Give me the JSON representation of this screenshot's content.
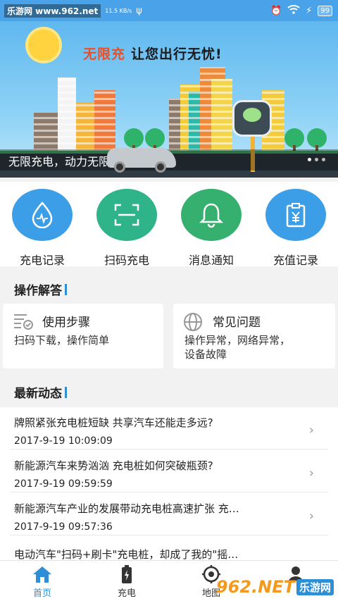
{
  "status_bar": {
    "watermark": "乐游网 www.962.net",
    "speed": "11.5 KB/s",
    "battery": "99"
  },
  "banner": {
    "slogan_highlight": "无限充",
    "slogan_rest": "让您出行无忧!",
    "caption": "无限充电，动力无限"
  },
  "quick_actions": [
    {
      "label": "充电记录",
      "icon": "droplet-pulse-icon",
      "color": "#3d9ee8"
    },
    {
      "label": "扫码充电",
      "icon": "scan-icon",
      "color": "#2fb48a"
    },
    {
      "label": "消息通知",
      "icon": "bell-icon",
      "color": "#36b06e"
    },
    {
      "label": "充值记录",
      "icon": "yen-clipboard-icon",
      "color": "#3d9ee8"
    }
  ],
  "faq": {
    "title": "操作解答",
    "cards": [
      {
        "title": "使用步骤",
        "desc": "扫码下载，操作简单"
      },
      {
        "title": "常见问题",
        "desc_line1": "操作异常，网络异常，",
        "desc_line2": "设备故障"
      }
    ]
  },
  "news": {
    "title": "最新动态",
    "items": [
      {
        "title": "牌照紧张充电桩短缺 共享汽车还能走多远?",
        "date": "2017-9-19 10:09:09"
      },
      {
        "title": "新能源汽车来势汹汹 充电桩如何突破瓶颈?",
        "date": "2017-9-19 09:59:59"
      },
      {
        "title": "新能源汽车产业的发展带动充电桩高速扩张 充…",
        "date": "2017-9-19 09:57:36"
      },
      {
        "title": "电动汽车\"扫码+刷卡\"充电桩，却成了我的\"摇…",
        "date": ""
      }
    ]
  },
  "tabbar": {
    "tabs": [
      {
        "label": "首页",
        "icon": "home-icon",
        "active": true
      },
      {
        "label": "充电",
        "icon": "battery-bolt-icon",
        "active": false
      },
      {
        "label": "地图",
        "icon": "location-target-icon",
        "active": false
      },
      {
        "label": "",
        "icon": "user-icon",
        "active": false
      }
    ]
  },
  "corner_watermark": {
    "brand": "962.NET",
    "sub": "乐游网"
  },
  "colors": {
    "accent": "#2e8fd6",
    "status_bar": "#4aa3e8"
  }
}
